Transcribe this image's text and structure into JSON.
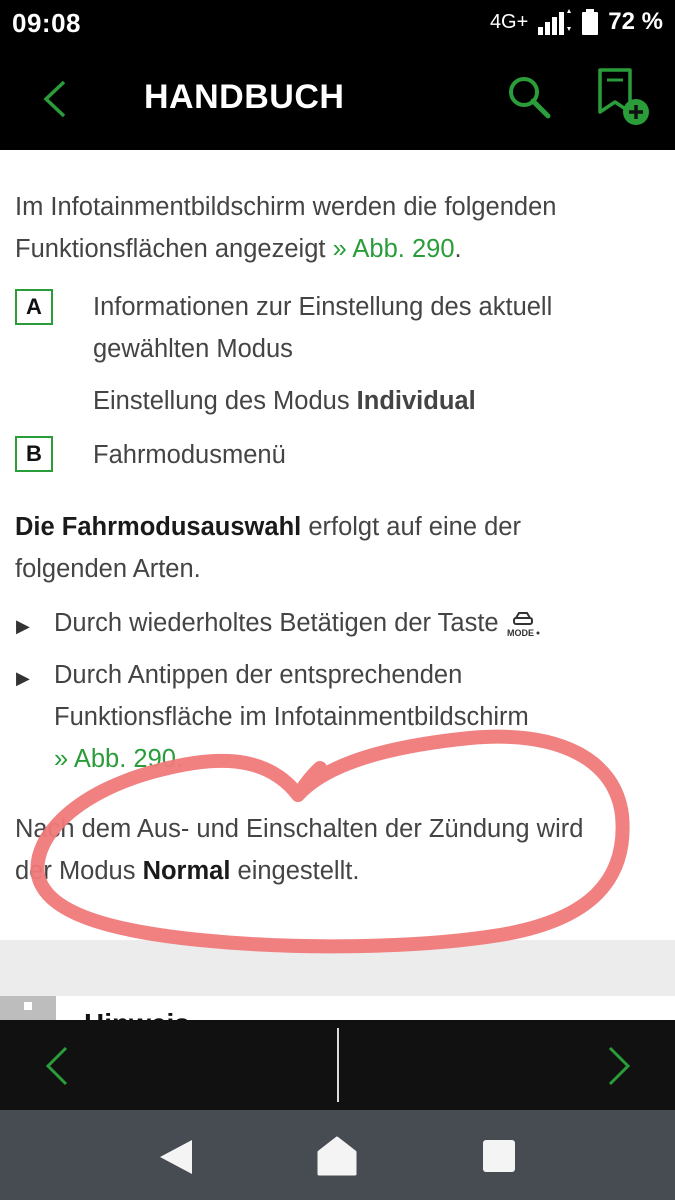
{
  "status": {
    "time": "09:08",
    "network": "4G+",
    "battery": "72 %"
  },
  "header": {
    "title": "HANDBUCH"
  },
  "content": {
    "intro_text": "Im Infotainmentbildschirm werden die folgenden",
    "intro_text2": "Funktionsflächen angezeigt",
    "intro_link": "» Abb. 290",
    "intro_end": ".",
    "items": [
      {
        "key": "A",
        "line1": "Informationen zur Einstellung des aktuell",
        "line2": "gewählten Modus",
        "line3_prefix": "Einstellung des Modus ",
        "line3_bold": "Individual"
      },
      {
        "key": "B",
        "line1": "Fahrmodusmenü"
      }
    ],
    "para2_bold": "Die Fahrmodusauswahl",
    "para2_rest": " erfolgt auf eine der",
    "para2_line2": "folgenden Arten.",
    "bullets": [
      {
        "text": "Durch wiederholtes Betätigen der Taste "
      },
      {
        "line1": "Durch Antippen der entsprechenden",
        "line2": "Funktionsfläche im Infotainmentbildschirm",
        "link": "» Abb. 290",
        "end": "."
      }
    ],
    "mode_icon_label": "MODE",
    "final_line1": "Nach dem Aus- und Einschalten der Zündung wird",
    "final_prefix": "der Modus ",
    "final_bold": "Normal",
    "final_suffix": " eingestellt.",
    "hint_label": "Hinweis"
  },
  "colors": {
    "accent": "#2a9d3a",
    "marker": "#f07a7a"
  }
}
